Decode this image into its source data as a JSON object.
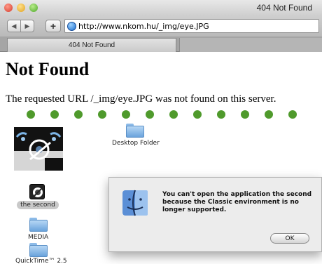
{
  "browser": {
    "window_title": "404 Not Found",
    "address": "http://www.nkom.hu/_img/eye.JPG",
    "tab_title": "404 Not Found",
    "back_glyph": "◀",
    "forward_glyph": "▶",
    "add_glyph": "+"
  },
  "page": {
    "heading": "Not Found",
    "message": "The requested URL /_img/eye.JPG was not found on this server.",
    "accent_dot_color": "#4f9a2c"
  },
  "desktop": {
    "folder_label": "Desktop Folder",
    "app_label": "the second",
    "media_label": "MEDIA",
    "quicktime_label": "QuickTime™ 2.5"
  },
  "dialog": {
    "message": "You can't open the application the second because the Classic environment is no longer supported.",
    "ok_label": "OK"
  }
}
